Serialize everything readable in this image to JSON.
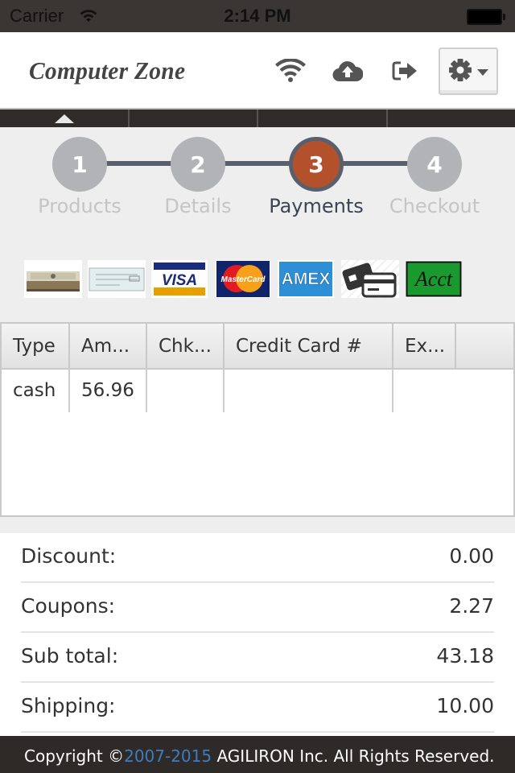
{
  "status_bar": {
    "carrier": "Carrier",
    "time": "2:14 PM",
    "battery_level": 1.0
  },
  "header": {
    "brand": "Computer Zone",
    "icons": {
      "wifi": "wifi-icon",
      "upload": "cloud-upload-icon",
      "logout": "sign-out-icon",
      "settings": "gear-icon"
    }
  },
  "steps": [
    {
      "number": "1",
      "label": "Products",
      "active": false
    },
    {
      "number": "2",
      "label": "Details",
      "active": false
    },
    {
      "number": "3",
      "label": "Payments",
      "active": true
    },
    {
      "number": "4",
      "label": "Checkout",
      "active": false
    }
  ],
  "payment_methods": [
    {
      "name": "cash",
      "label": "Cash"
    },
    {
      "name": "check",
      "label": "Check"
    },
    {
      "name": "visa",
      "label": "VISA"
    },
    {
      "name": "mastercard",
      "label": "MasterCard"
    },
    {
      "name": "amex",
      "label": "AMEX"
    },
    {
      "name": "credit-card",
      "label": "Card"
    },
    {
      "name": "account",
      "label": "Acct"
    }
  ],
  "payments_table": {
    "columns": [
      "Type",
      "Am...",
      "Chk...",
      "Credit Card #",
      "Ex...",
      ""
    ],
    "rows": [
      [
        "cash",
        "56.96",
        "",
        "",
        "",
        ""
      ]
    ]
  },
  "totals": [
    {
      "label": "Discount:",
      "value": "0.00"
    },
    {
      "label": "Coupons:",
      "value": "2.27"
    },
    {
      "label": "Sub total:",
      "value": "43.18"
    },
    {
      "label": "Shipping:",
      "value": "10.00"
    }
  ],
  "footer": {
    "prefix": "Copyright ©",
    "years": "2007-2015",
    "suffix": " AGILIRON Inc. All Rights Reserved."
  },
  "colors": {
    "active_step": "#b4512d",
    "step_line": "#59606c",
    "inactive_step": "#b1b3b6",
    "footer_link": "#3d7dbf",
    "acct_green": "#1a9a2e"
  }
}
